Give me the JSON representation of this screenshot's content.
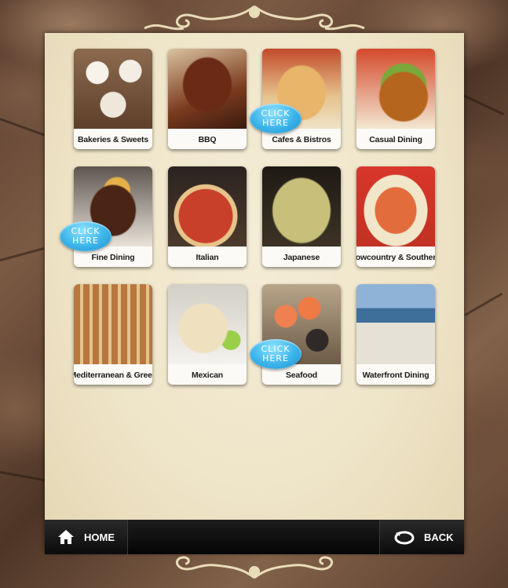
{
  "categories": [
    {
      "label": "Bakeries & Sweets",
      "photo": "cupcakes"
    },
    {
      "label": "BBQ",
      "photo": "ribs"
    },
    {
      "label": "Cafes & Bistros",
      "photo": "sandwich"
    },
    {
      "label": "Casual Dining",
      "photo": "burger"
    },
    {
      "label": "Fine Dining",
      "photo": "steak"
    },
    {
      "label": "Italian",
      "photo": "pizza"
    },
    {
      "label": "Japanese",
      "photo": "noodles"
    },
    {
      "label": "Lowcountry & Southern",
      "photo": "shrimp-and-grits"
    },
    {
      "label": "Mediterranean & Greek",
      "photo": "kebabs"
    },
    {
      "label": "Mexican",
      "photo": "fajitas"
    },
    {
      "label": "Seafood",
      "photo": "seafood-platter"
    },
    {
      "label": "Waterfront Dining",
      "photo": "waterfront-table"
    }
  ],
  "click_badge": {
    "line1": "CLICK",
    "line2": "HERE"
  },
  "nav": {
    "home_label": "HOME",
    "back_label": "BACK"
  },
  "colors": {
    "badge": "#3bb4ea",
    "panel": "#efe5c9",
    "bar": "#0a0a0a"
  }
}
